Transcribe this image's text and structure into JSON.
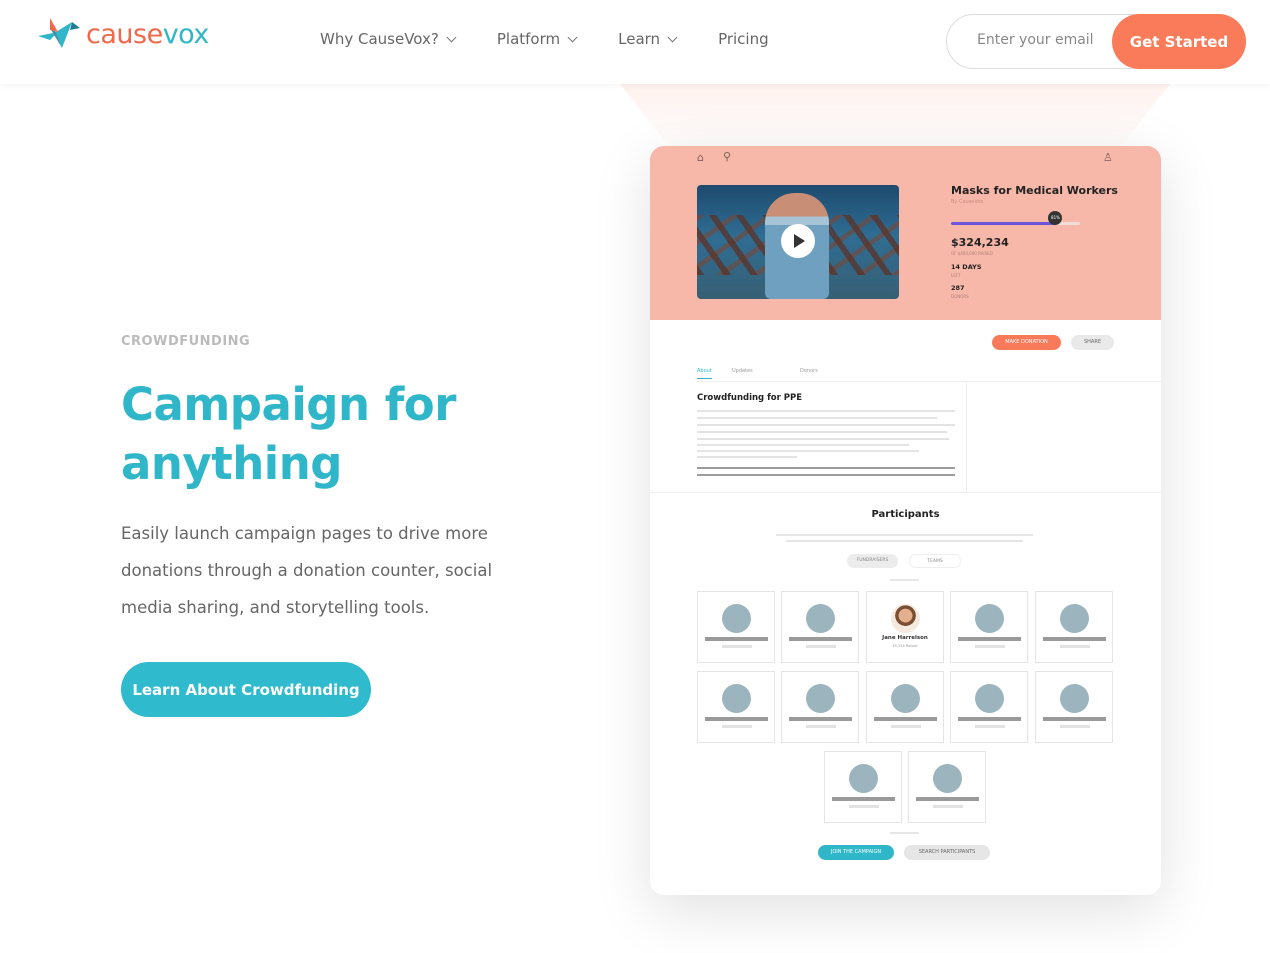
{
  "brand": {
    "name_part1": "cause",
    "name_part2": "vox",
    "primary": "#2fb6c9",
    "accent": "#fa7b59"
  },
  "nav": {
    "items": [
      "Why CauseVox?",
      "Platform",
      "Learn",
      "Pricing"
    ]
  },
  "signup": {
    "placeholder": "Enter your email",
    "button": "Get Started"
  },
  "hero": {
    "eyebrow": "CROWDFUNDING",
    "headline": "Campaign for anything",
    "description": "Easily launch campaign pages to drive more donations through a donation counter, social media sharing, and storytelling tools.",
    "cta": "Learn About Crowdfunding"
  },
  "mockup": {
    "campaign_title": "Masks for Medical Workers",
    "by": "By CauseVox",
    "progress_percent": 81,
    "progress_label": "81%",
    "amount": "$324,234",
    "amount_sub": "OF $400,000 RAISED",
    "days": "14 DAYS",
    "days_sub": "LEFT",
    "donors": "287",
    "donors_sub": "DONORS",
    "buttons": {
      "donate": "MAKE DONATION",
      "share": "SHARE"
    },
    "tabs": [
      "About",
      "Updates",
      "Donors"
    ],
    "about_title": "Crowdfunding for PPE",
    "participants_title": "Participants",
    "segments": [
      "FUNDRAISERS",
      "TEAMS"
    ],
    "featured_participant": {
      "name": "Jane Harrelson",
      "sub": "$5,324 Raised"
    },
    "footer_buttons": {
      "join": "JOIN THE CAMPAIGN",
      "search": "SEARCH PARTICIPANTS"
    }
  }
}
